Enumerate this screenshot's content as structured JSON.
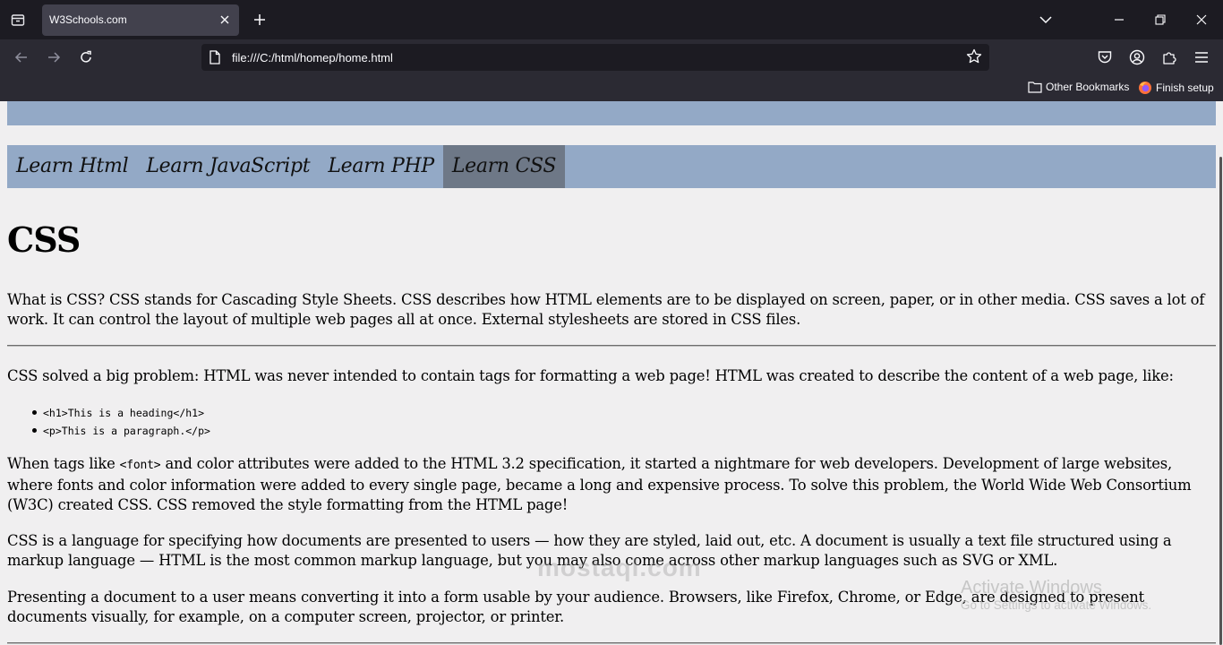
{
  "browser": {
    "tab_title": "W3Schools.com",
    "url": "file:///C:/html/homep/home.html",
    "bookmarks": {
      "other": "Other Bookmarks",
      "finish_setup": "Finish setup"
    },
    "icons": {
      "tab_list": "tab-list-icon",
      "new_tab": "plus-icon",
      "list_all_tabs": "chevron-down-icon",
      "minimize": "minimize-icon",
      "restore": "restore-icon",
      "close": "close-icon",
      "back": "arrow-left-icon",
      "forward": "arrow-right-icon",
      "reload": "reload-icon",
      "bookmark_star": "star-icon",
      "pocket": "pocket-icon",
      "account": "account-icon",
      "extensions": "puzzle-icon",
      "menu": "hamburger-icon"
    }
  },
  "page": {
    "menu": [
      {
        "label": "Learn Html",
        "active": false
      },
      {
        "label": "Learn JavaScript",
        "active": false
      },
      {
        "label": "Learn PHP",
        "active": false
      },
      {
        "label": "Learn CSS",
        "active": true
      }
    ],
    "title": "CSS",
    "intro": "What is CSS? CSS stands for Cascading Style Sheets. CSS describes how HTML elements are to be displayed on screen, paper, or in other media. CSS saves a lot of work. It can control the layout of multiple web pages all at once. External stylesheets are stored in CSS files.",
    "problem": "CSS solved a big problem: HTML was never intended to contain tags for formatting a web page! HTML was created to describe the content of a web page, like:",
    "code_items": [
      "<h1>This is a heading</h1>",
      "<p>This is a paragraph.</p>"
    ],
    "history_before": "When tags like ",
    "history_code": "<font>",
    "history_after": " and color attributes were added to the HTML 3.2 specification, it started a nightmare for web developers. Development of large websites, where fonts and color information were added to every single page, became a long and expensive process. To solve this problem, the World Wide Web Consortium (W3C) created CSS. CSS removed the style formatting from the HTML page!",
    "language": "CSS is a language for specifying how documents are presented to users — how they are styled, laid out, etc. A document is usually a text file structured using a markup language — HTML is the most common markup language, but you may also come across other markup languages such as SVG or XML.",
    "presenting": "Presenting a document to a user means converting it into a form usable by your audience. Browsers, like Firefox, Chrome, or Edge, are designed to present documents visually, for example, on a computer screen, projector, or printer."
  },
  "overlay": {
    "activate_title": "Activate Windows",
    "activate_sub": "Go to Settings to activate Windows.",
    "watermark_logo": "mostaql.com"
  },
  "colors": {
    "menu_bg": "#93a9c6",
    "menu_active": "#6e7887",
    "page_bg": "#f0eff0",
    "chrome_dark": "#1c1b22",
    "chrome": "#2b2a33"
  }
}
